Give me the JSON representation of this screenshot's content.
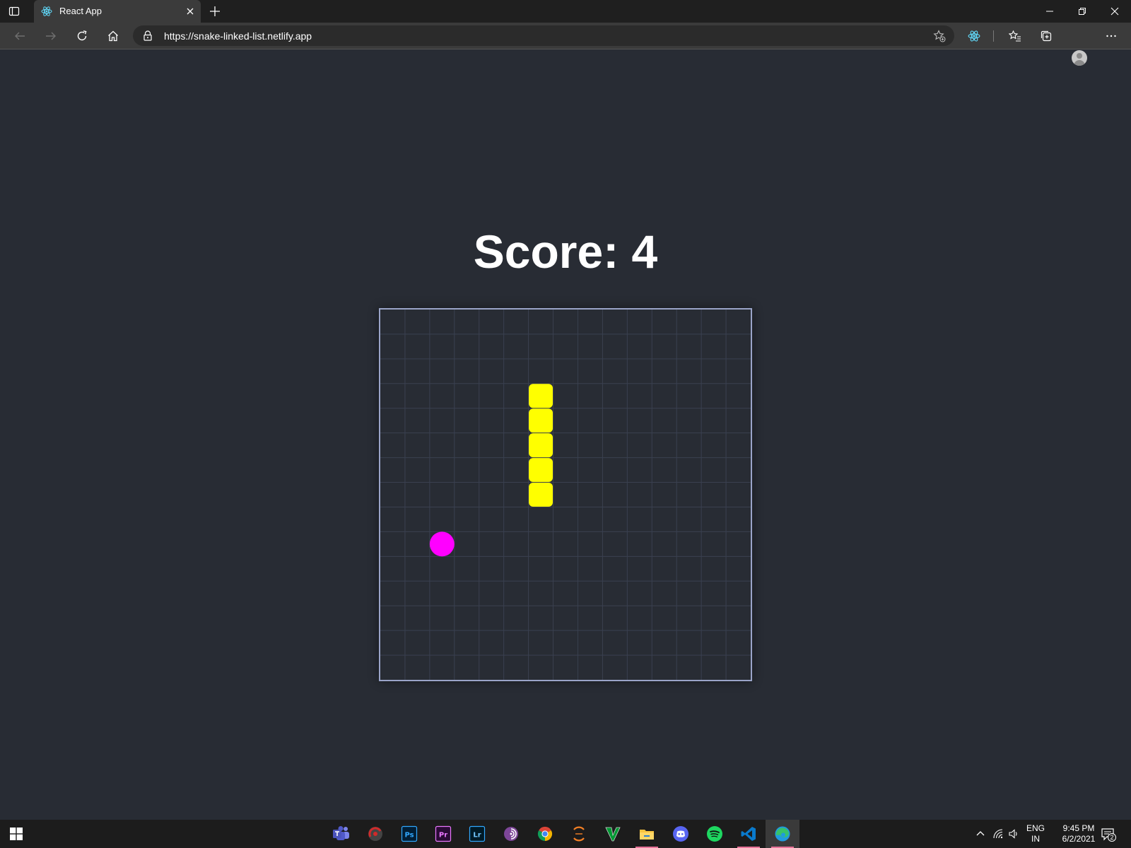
{
  "browser": {
    "tab": {
      "title": "React App",
      "favicon": "react-icon"
    },
    "address": {
      "scheme": "https://",
      "host": "snake-linked-list.netlify.app"
    },
    "icons": {
      "back": "arrow-left-icon",
      "forward": "arrow-right-icon",
      "refresh": "refresh-icon",
      "home": "home-icon",
      "favorites_add": "star-add-icon",
      "extension": "react-icon",
      "favorites": "favorites-icon",
      "collections": "collections-icon",
      "profile": "avatar",
      "more": "more-icon"
    }
  },
  "game": {
    "score_text": "Score: 4",
    "grid": {
      "columns": 15,
      "rows": 15
    },
    "snake": [
      {
        "col": 6,
        "row": 3
      },
      {
        "col": 6,
        "row": 4
      },
      {
        "col": 6,
        "row": 5
      },
      {
        "col": 6,
        "row": 6
      },
      {
        "col": 6,
        "row": 7
      }
    ],
    "food": {
      "col": 2,
      "row": 9
    },
    "colors": {
      "background": "#282c34",
      "grid_line": "#3a4050",
      "border": "#9aa4c8",
      "snake": "#ffff00",
      "food": "#ff00ff",
      "score": "#ffffff"
    }
  },
  "taskbar": {
    "apps": [
      {
        "name": "teams-icon",
        "running": false
      },
      {
        "name": "redshift-icon",
        "running": false
      },
      {
        "name": "photoshop-icon",
        "label": "Ps",
        "running": false
      },
      {
        "name": "premiere-icon",
        "label": "Pr",
        "running": false
      },
      {
        "name": "lightroom-icon",
        "label": "Lr",
        "running": false
      },
      {
        "name": "tor-icon",
        "running": false
      },
      {
        "name": "chrome-icon",
        "running": false
      },
      {
        "name": "eclipse-icon",
        "running": false
      },
      {
        "name": "vim-icon",
        "running": false
      },
      {
        "name": "file-explorer-icon",
        "running": true
      },
      {
        "name": "discord-icon",
        "running": false
      },
      {
        "name": "spotify-icon",
        "running": false
      },
      {
        "name": "vscode-icon",
        "running": true
      },
      {
        "name": "edge-icon",
        "running": true,
        "active": true
      }
    ],
    "tray": {
      "language_line1": "ENG",
      "language_line2": "IN",
      "time": "9:45 PM",
      "date": "6/2/2021",
      "notification_count": "2"
    }
  }
}
